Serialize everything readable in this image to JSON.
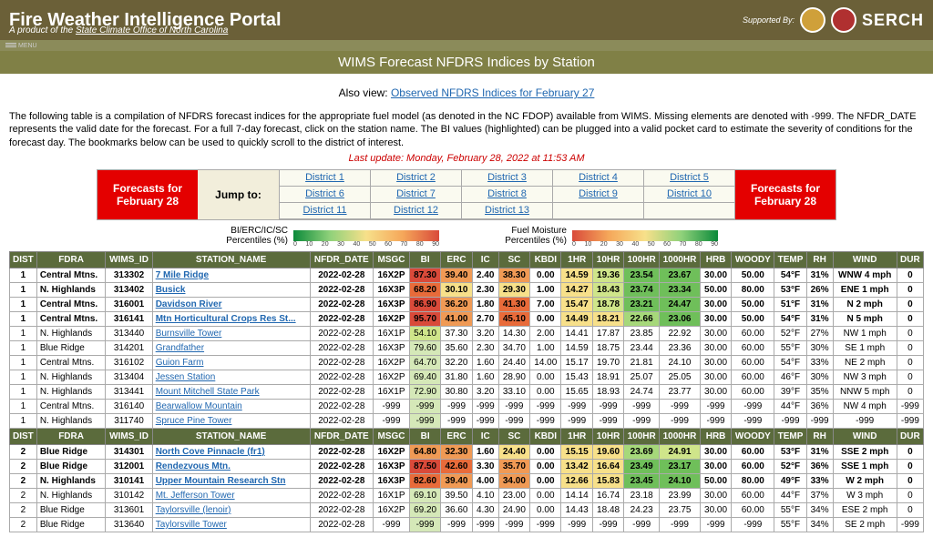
{
  "header": {
    "title": "Fire Weather Intelligence Portal",
    "subtitle_prefix": "A product of the ",
    "subtitle_link": "State Climate Office of North Carolina",
    "supported_by": "Supported By:",
    "serch": "SERCH",
    "menu_label": "MENU"
  },
  "subhead": "WIMS Forecast NFDRS Indices by Station",
  "alsoview": {
    "prefix": "Also view: ",
    "link": "Observed NFDRS Indices for February 27"
  },
  "description": "The following table is a compilation of NFDRS forecast indices for the appropriate fuel model (as denoted in the NC FDOP) available from WIMS. Missing elements are denoted with -999. The NFDR_DATE represents the valid date for the forecast. For a full 7-day forecast, click on the station name. The BI values (highlighted) can be plugged into a valid pocket card to estimate the severity of conditions for the forecast day. The bookmarks below can be used to quickly scroll to the district of interest.",
  "last_update": "Last update: Monday, February 28, 2022 at 11:53 AM",
  "jump": {
    "forecasts_label": "Forecasts for February 28",
    "jumpto": "Jump to:",
    "districts": [
      "District 1",
      "District 2",
      "District 3",
      "District 4",
      "District 5",
      "District 6",
      "District 7",
      "District 8",
      "District 9",
      "District 10",
      "District 11",
      "District 12",
      "District 13"
    ]
  },
  "legend": {
    "left_label": "BI/ERC/IC/SC Percentiles (%)",
    "right_label": "Fuel Moisture Percentiles (%)",
    "ticks": [
      "0",
      "10",
      "20",
      "30",
      "40",
      "50",
      "60",
      "70",
      "80",
      "90"
    ]
  },
  "columns": [
    "DIST",
    "FDRA",
    "WIMS_ID",
    "STATION_NAME",
    "NFDR_DATE",
    "MSGC",
    "BI",
    "ERC",
    "IC",
    "SC",
    "KBDI",
    "1HR",
    "10HR",
    "100HR",
    "1000HR",
    "HRB",
    "WOODY",
    "TEMP",
    "RH",
    "WIND",
    "DUR"
  ],
  "rows": [
    {
      "bold": true,
      "dist": "1",
      "fdra": "Central Mtns.",
      "wims": "313302",
      "stn": "7 Mile Ridge",
      "date": "2022-02-28",
      "msgc": "16X2P",
      "bi": "87.30",
      "bic": "o0",
      "erc": "39.40",
      "ercc": "o2",
      "ic": "2.40",
      "sc": "38.30",
      "scc": "o2",
      "kbdi": "0.00",
      "h1": "14.59",
      "h1c": "o3",
      "h10": "19.36",
      "h10c": "o4",
      "h100": "23.54",
      "h100c": "o6",
      "h1000": "23.67",
      "h1000c": "o6",
      "hrb": "30.00",
      "woody": "50.00",
      "temp": "54°F",
      "rh": "31%",
      "wind": "WNW 4 mph",
      "dur": "0"
    },
    {
      "bold": true,
      "dist": "1",
      "fdra": "N. Highlands",
      "wims": "313402",
      "stn": "Busick",
      "date": "2022-02-28",
      "msgc": "16X3P",
      "bi": "68.20",
      "bic": "o1",
      "erc": "30.10",
      "ercc": "o3",
      "ic": "2.30",
      "sc": "29.30",
      "scc": "o3",
      "kbdi": "1.00",
      "h1": "14.27",
      "h1c": "o3",
      "h10": "18.43",
      "h10c": "o4",
      "h100": "23.74",
      "h100c": "o6",
      "h1000": "23.34",
      "h1000c": "o6",
      "hrb": "50.00",
      "woody": "80.00",
      "temp": "53°F",
      "rh": "26%",
      "wind": "ENE 1 mph",
      "dur": "0"
    },
    {
      "bold": true,
      "dist": "1",
      "fdra": "Central Mtns.",
      "wims": "316001",
      "stn": "Davidson River",
      "date": "2022-02-28",
      "msgc": "16X3P",
      "bi": "86.90",
      "bic": "o0",
      "erc": "36.20",
      "ercc": "o2",
      "ic": "1.80",
      "sc": "41.30",
      "scc": "o1",
      "kbdi": "7.00",
      "h1": "15.47",
      "h1c": "o3",
      "h10": "18.78",
      "h10c": "o4",
      "h100": "23.21",
      "h100c": "o6",
      "h1000": "24.47",
      "h1000c": "o6",
      "hrb": "30.00",
      "woody": "50.00",
      "temp": "51°F",
      "rh": "31%",
      "wind": "N 2 mph",
      "dur": "0"
    },
    {
      "bold": true,
      "dist": "1",
      "fdra": "Central Mtns.",
      "wims": "316141",
      "stn": "Mtn Horticultural Crops Res St...",
      "date": "2022-02-28",
      "msgc": "16X2P",
      "bi": "95.70",
      "bic": "o0",
      "erc": "41.00",
      "ercc": "o2",
      "ic": "2.70",
      "sc": "45.10",
      "scc": "o1",
      "kbdi": "0.00",
      "h1": "14.49",
      "h1c": "o3",
      "h10": "18.21",
      "h10c": "o3",
      "h100": "22.66",
      "h100c": "o5",
      "h1000": "23.06",
      "h1000c": "o6",
      "hrb": "30.00",
      "woody": "50.00",
      "temp": "54°F",
      "rh": "31%",
      "wind": "N 5 mph",
      "dur": "0"
    },
    {
      "bold": false,
      "dist": "1",
      "fdra": "N. Highlands",
      "wims": "313440",
      "stn": "Burnsville Tower",
      "date": "2022-02-28",
      "msgc": "16X1P",
      "bi": "54.10",
      "bic": "o4",
      "erc": "37.30",
      "ercc": "",
      "ic": "3.20",
      "sc": "14.30",
      "scc": "",
      "kbdi": "2.00",
      "h1": "14.41",
      "h1c": "",
      "h10": "17.87",
      "h10c": "",
      "h100": "23.85",
      "h100c": "",
      "h1000": "22.92",
      "h1000c": "",
      "hrb": "30.00",
      "woody": "60.00",
      "temp": "52°F",
      "rh": "27%",
      "wind": "NW 1 mph",
      "dur": "0"
    },
    {
      "bold": false,
      "dist": "1",
      "fdra": "Blue Ridge",
      "wims": "314201",
      "stn": "Grandfather",
      "date": "2022-02-28",
      "msgc": "16X3P",
      "bi": "79.60",
      "bic": "d5",
      "erc": "35.60",
      "ercc": "",
      "ic": "2.30",
      "sc": "34.70",
      "scc": "",
      "kbdi": "1.00",
      "h1": "14.59",
      "h1c": "",
      "h10": "18.75",
      "h10c": "",
      "h100": "23.44",
      "h100c": "",
      "h1000": "23.36",
      "h1000c": "",
      "hrb": "30.00",
      "woody": "60.00",
      "temp": "55°F",
      "rh": "30%",
      "wind": "SE 1 mph",
      "dur": "0"
    },
    {
      "bold": false,
      "dist": "1",
      "fdra": "Central Mtns.",
      "wims": "316102",
      "stn": "Guion Farm",
      "date": "2022-02-28",
      "msgc": "16X2P",
      "bi": "64.70",
      "bic": "d5",
      "erc": "32.20",
      "ercc": "",
      "ic": "1.60",
      "sc": "24.40",
      "scc": "",
      "kbdi": "14.00",
      "h1": "15.17",
      "h1c": "",
      "h10": "19.70",
      "h10c": "",
      "h100": "21.81",
      "h100c": "",
      "h1000": "24.10",
      "h1000c": "",
      "hrb": "30.00",
      "woody": "60.00",
      "temp": "54°F",
      "rh": "33%",
      "wind": "NE 2 mph",
      "dur": "0"
    },
    {
      "bold": false,
      "dist": "1",
      "fdra": "N. Highlands",
      "wims": "313404",
      "stn": "Jessen Station",
      "date": "2022-02-28",
      "msgc": "16X2P",
      "bi": "69.40",
      "bic": "d5",
      "erc": "31.80",
      "ercc": "",
      "ic": "1.60",
      "sc": "28.90",
      "scc": "",
      "kbdi": "0.00",
      "h1": "15.43",
      "h1c": "",
      "h10": "18.91",
      "h10c": "",
      "h100": "25.07",
      "h100c": "",
      "h1000": "25.05",
      "h1000c": "",
      "hrb": "30.00",
      "woody": "60.00",
      "temp": "46°F",
      "rh": "30%",
      "wind": "NW 3 mph",
      "dur": "0"
    },
    {
      "bold": false,
      "dist": "1",
      "fdra": "N. Highlands",
      "wims": "313441",
      "stn": "Mount Mitchell State Park",
      "date": "2022-02-28",
      "msgc": "16X1P",
      "bi": "72.90",
      "bic": "d5",
      "erc": "30.80",
      "ercc": "",
      "ic": "3.20",
      "sc": "33.10",
      "scc": "",
      "kbdi": "0.00",
      "h1": "15.65",
      "h1c": "",
      "h10": "18.93",
      "h10c": "",
      "h100": "24.74",
      "h100c": "",
      "h1000": "23.77",
      "h1000c": "",
      "hrb": "30.00",
      "woody": "60.00",
      "temp": "39°F",
      "rh": "35%",
      "wind": "NNW 5 mph",
      "dur": "0"
    },
    {
      "bold": false,
      "dist": "1",
      "fdra": "Central Mtns.",
      "wims": "316140",
      "stn": "Bearwallow Mountain",
      "date": "2022-02-28",
      "msgc": "-999",
      "bi": "-999",
      "bic": "d5",
      "erc": "-999",
      "ercc": "",
      "ic": "-999",
      "sc": "-999",
      "scc": "",
      "kbdi": "-999",
      "h1": "-999",
      "h1c": "",
      "h10": "-999",
      "h10c": "",
      "h100": "-999",
      "h100c": "",
      "h1000": "-999",
      "h1000c": "",
      "hrb": "-999",
      "woody": "-999",
      "temp": "44°F",
      "rh": "36%",
      "wind": "NW 4 mph",
      "dur": "-999"
    },
    {
      "bold": false,
      "dist": "1",
      "fdra": "N. Highlands",
      "wims": "311740",
      "stn": "Spruce Pine Tower",
      "date": "2022-02-28",
      "msgc": "-999",
      "bi": "-999",
      "bic": "d5",
      "erc": "-999",
      "ercc": "",
      "ic": "-999",
      "sc": "-999",
      "scc": "",
      "kbdi": "-999",
      "h1": "-999",
      "h1c": "",
      "h10": "-999",
      "h10c": "",
      "h100": "-999",
      "h100c": "",
      "h1000": "-999",
      "h1000c": "",
      "hrb": "-999",
      "woody": "-999",
      "temp": "-999",
      "rh": "-999",
      "wind": "-999",
      "dur": "-999"
    },
    {
      "bold": true,
      "dist": "2",
      "fdra": "Blue Ridge",
      "wims": "314301",
      "stn": "North Cove Pinnacle (fr1)",
      "date": "2022-02-28",
      "msgc": "16X2P",
      "bi": "64.80",
      "bic": "o2",
      "erc": "32.30",
      "ercc": "o2",
      "ic": "1.60",
      "sc": "24.40",
      "scc": "o3",
      "kbdi": "0.00",
      "h1": "15.15",
      "h1c": "o3",
      "h10": "19.60",
      "h10c": "o3",
      "h100": "23.69",
      "h100c": "o5",
      "h1000": "24.91",
      "h1000c": "o4",
      "hrb": "30.00",
      "woody": "60.00",
      "temp": "53°F",
      "rh": "31%",
      "wind": "SSE 2 mph",
      "dur": "0"
    },
    {
      "bold": true,
      "dist": "2",
      "fdra": "Blue Ridge",
      "wims": "312001",
      "stn": "Rendezvous Mtn.",
      "date": "2022-02-28",
      "msgc": "16X3P",
      "bi": "87.50",
      "bic": "o0",
      "erc": "42.60",
      "ercc": "o1",
      "ic": "3.30",
      "sc": "35.70",
      "scc": "o2",
      "kbdi": "0.00",
      "h1": "13.42",
      "h1c": "o3",
      "h10": "16.64",
      "h10c": "o3",
      "h100": "23.49",
      "h100c": "o6",
      "h1000": "23.17",
      "h1000c": "o6",
      "hrb": "30.00",
      "woody": "60.00",
      "temp": "52°F",
      "rh": "36%",
      "wind": "SSE 1 mph",
      "dur": "0"
    },
    {
      "bold": true,
      "dist": "2",
      "fdra": "N. Highlands",
      "wims": "310141",
      "stn": "Upper Mountain Research Stn",
      "date": "2022-02-28",
      "msgc": "16X3P",
      "bi": "82.60",
      "bic": "o1",
      "erc": "39.40",
      "ercc": "o2",
      "ic": "4.00",
      "sc": "34.00",
      "scc": "o2",
      "kbdi": "0.00",
      "h1": "12.66",
      "h1c": "o3",
      "h10": "15.83",
      "h10c": "o3",
      "h100": "23.45",
      "h100c": "o6",
      "h1000": "24.10",
      "h1000c": "o6",
      "hrb": "50.00",
      "woody": "80.00",
      "temp": "49°F",
      "rh": "33%",
      "wind": "W 2 mph",
      "dur": "0"
    },
    {
      "bold": false,
      "dist": "2",
      "fdra": "N. Highlands",
      "wims": "310142",
      "stn": "Mt. Jefferson Tower",
      "date": "2022-02-28",
      "msgc": "16X1P",
      "bi": "69.10",
      "bic": "d5",
      "erc": "39.50",
      "ercc": "",
      "ic": "4.10",
      "sc": "23.00",
      "scc": "",
      "kbdi": "0.00",
      "h1": "14.14",
      "h1c": "",
      "h10": "16.74",
      "h10c": "",
      "h100": "23.18",
      "h100c": "",
      "h1000": "23.99",
      "h1000c": "",
      "hrb": "30.00",
      "woody": "60.00",
      "temp": "44°F",
      "rh": "37%",
      "wind": "W 3 mph",
      "dur": "0"
    },
    {
      "bold": false,
      "dist": "2",
      "fdra": "Blue Ridge",
      "wims": "313601",
      "stn": "Taylorsville (lenoir)",
      "date": "2022-02-28",
      "msgc": "16X2P",
      "bi": "69.20",
      "bic": "d5",
      "erc": "36.60",
      "ercc": "",
      "ic": "4.30",
      "sc": "24.90",
      "scc": "",
      "kbdi": "0.00",
      "h1": "14.43",
      "h1c": "",
      "h10": "18.48",
      "h10c": "",
      "h100": "24.23",
      "h100c": "",
      "h1000": "23.75",
      "h1000c": "",
      "hrb": "30.00",
      "woody": "60.00",
      "temp": "55°F",
      "rh": "34%",
      "wind": "ESE 2 mph",
      "dur": "0"
    },
    {
      "bold": false,
      "dist": "2",
      "fdra": "Blue Ridge",
      "wims": "313640",
      "stn": "Taylorsville Tower",
      "date": "2022-02-28",
      "msgc": "-999",
      "bi": "-999",
      "bic": "d5",
      "erc": "-999",
      "ercc": "",
      "ic": "-999",
      "sc": "-999",
      "scc": "",
      "kbdi": "-999",
      "h1": "-999",
      "h1c": "",
      "h10": "-999",
      "h10c": "",
      "h100": "-999",
      "h100c": "",
      "h1000": "-999",
      "h1000c": "",
      "hrb": "-999",
      "woody": "-999",
      "temp": "55°F",
      "rh": "34%",
      "wind": "SE 2 mph",
      "dur": "-999"
    }
  ]
}
